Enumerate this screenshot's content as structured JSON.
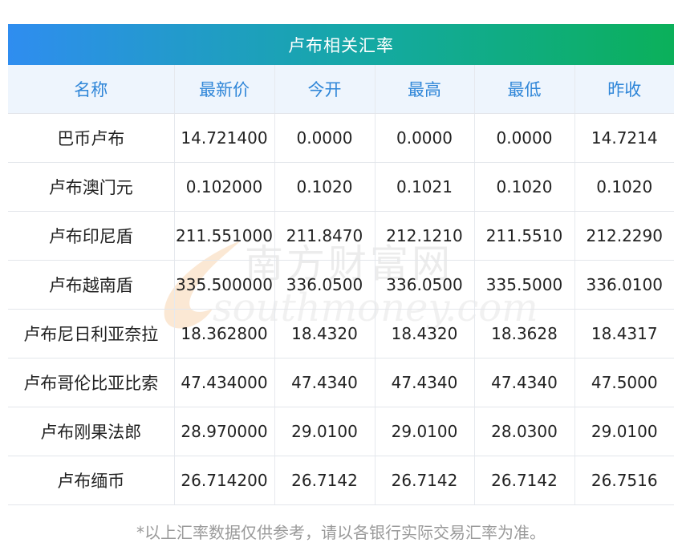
{
  "title": "卢布相关汇率",
  "columns": [
    "名称",
    "最新价",
    "今开",
    "最高",
    "最低",
    "昨收"
  ],
  "rows": [
    [
      "巴币卢布",
      "14.721400",
      "0.0000",
      "0.0000",
      "0.0000",
      "14.7214"
    ],
    [
      "卢布澳门元",
      "0.102000",
      "0.1020",
      "0.1021",
      "0.1020",
      "0.1020"
    ],
    [
      "卢布印尼盾",
      "211.551000",
      "211.8470",
      "212.1210",
      "211.5510",
      "212.2290"
    ],
    [
      "卢布越南盾",
      "335.500000",
      "336.0500",
      "336.0500",
      "335.5000",
      "336.0100"
    ],
    [
      "卢布尼日利亚奈拉",
      "18.362800",
      "18.4320",
      "18.4320",
      "18.3628",
      "18.4317"
    ],
    [
      "卢布哥伦比亚比索",
      "47.434000",
      "47.4340",
      "47.4340",
      "47.4340",
      "47.5000"
    ],
    [
      "卢布刚果法郎",
      "28.970000",
      "29.0100",
      "29.0100",
      "28.0300",
      "29.0100"
    ],
    [
      "卢布缅币",
      "26.714200",
      "26.7142",
      "26.7142",
      "26.7142",
      "26.7516"
    ]
  ],
  "watermark": {
    "cn": "南方财富网",
    "en": "southmoney.com"
  },
  "footnote": "*以上汇率数据仅供参考，请以各银行实际交易汇率为准。",
  "colors": {
    "header_gradient_start": "#2f8df0",
    "header_gradient_end": "#0bb05a",
    "column_header_text": "#2f86d8",
    "column_header_bg": "#eef5fd",
    "footnote_text": "#9a9a9a"
  }
}
